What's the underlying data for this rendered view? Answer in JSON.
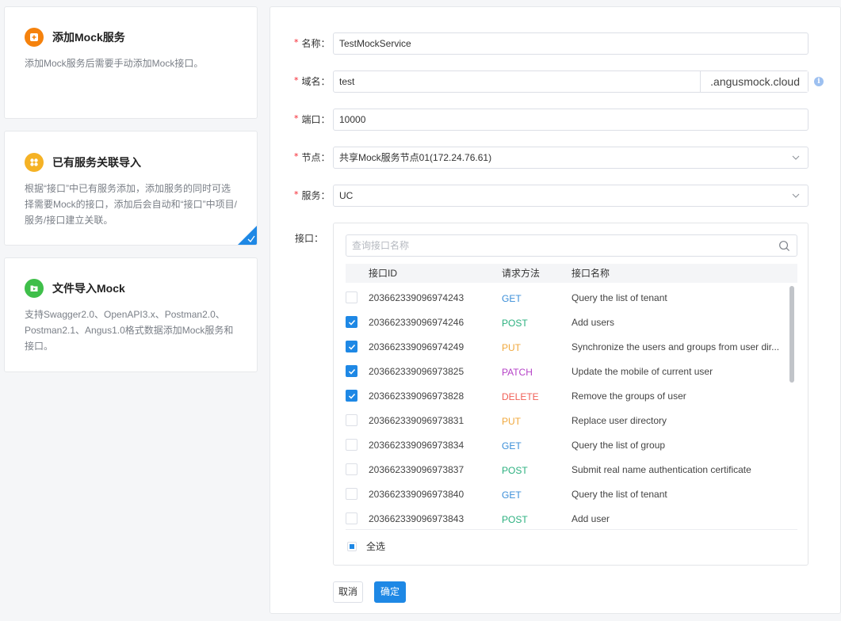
{
  "cards": [
    {
      "title": "添加Mock服务",
      "desc": "添加Mock服务后需要手动添加Mock接口。",
      "icon": "plus-icon",
      "color": "#f5820d",
      "selected": false
    },
    {
      "title": "已有服务关联导入",
      "desc": "根据“接口”中已有服务添加，添加服务的同时可选择需要Mock的接口，添加后会自动和“接口”中项目/服务/接口建立关联。",
      "icon": "grid-icon",
      "color": "#f5b225",
      "selected": true
    },
    {
      "title": "文件导入Mock",
      "desc": "支持Swagger2.0、OpenAPI3.x、Postman2.0、Postman2.1、Angus1.0格式数据添加Mock服务和接口。",
      "icon": "file-icon",
      "color": "#3fbf4a",
      "selected": false
    }
  ],
  "form": {
    "name_label": "名称：",
    "name_value": "TestMockService",
    "domain_label": "域名：",
    "domain_value": "test",
    "domain_suffix": ".angusmock.cloud",
    "port_label": "端口：",
    "port_value": "10000",
    "node_label": "节点：",
    "node_value": "共享Mock服务节点01(172.24.76.61)",
    "service_label": "服务：",
    "service_value": "UC",
    "api_label": "接口："
  },
  "table": {
    "search_placeholder": "查询接口名称",
    "headers": {
      "id": "接口ID",
      "method": "请求方法",
      "name": "接口名称"
    },
    "rows": [
      {
        "id": "203662339096974243",
        "method": "GET",
        "name": "Query the list of tenant",
        "checked": false
      },
      {
        "id": "203662339096974246",
        "method": "POST",
        "name": "Add users",
        "checked": true
      },
      {
        "id": "203662339096974249",
        "method": "PUT",
        "name": "Synchronize the users and groups from user dir...",
        "checked": true
      },
      {
        "id": "203662339096973825",
        "method": "PATCH",
        "name": "Update the mobile of current user",
        "checked": true
      },
      {
        "id": "203662339096973828",
        "method": "DELETE",
        "name": "Remove the groups of user",
        "checked": true
      },
      {
        "id": "203662339096973831",
        "method": "PUT",
        "name": "Replace user directory",
        "checked": false
      },
      {
        "id": "203662339096973834",
        "method": "GET",
        "name": "Query the list of group",
        "checked": false
      },
      {
        "id": "203662339096973837",
        "method": "POST",
        "name": "Submit real name authentication certificate",
        "checked": false
      },
      {
        "id": "203662339096973840",
        "method": "GET",
        "name": "Query the list of tenant",
        "checked": false
      },
      {
        "id": "203662339096973843",
        "method": "POST",
        "name": "Add user",
        "checked": false
      }
    ],
    "select_all_label": "全选"
  },
  "method_colors": {
    "GET": "#3a8ed8",
    "POST": "#2bb07f",
    "PUT": "#f0a83c",
    "PATCH": "#b542c7",
    "DELETE": "#f05f56"
  },
  "buttons": {
    "cancel": "取消",
    "ok": "确定"
  },
  "accent": "#1e88e5"
}
